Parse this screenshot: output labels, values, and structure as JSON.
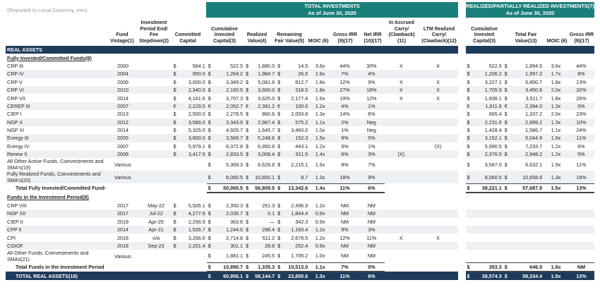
{
  "note": "(Reported in Local Currency, mm)",
  "bands": {
    "total": [
      "TOTAL INVESTMENTS",
      "As of June 30, 2020"
    ],
    "realized": [
      "REALIZED/PARTIALLY REALIZED INVESTMENTS(7)",
      "As of June 30, 2020"
    ]
  },
  "headers": {
    "vintage": "Fund Vintage(1)",
    "period": "Investment Period End/ Fee Stepdown(2)",
    "committed": "Committed Capital",
    "cum_invested": "Cumulative Invested Capital(3)",
    "realized_value": "Realized Value(4)",
    "remaining": "Remaining Fair Value(5)",
    "moic": "MOIC (6)",
    "gross_irr": "Gross IRR (9)(17)",
    "net_irr": "Net IRR (10)(17)",
    "accrued": "In Accrued Carry/ (Clawback)(11)",
    "ltm": "LTM Realized Carry/ (Clawback)(12)",
    "r_cum_invested": "Cumulative Invested Capital(3)",
    "r_fair_value": "Total Fair Value(13)",
    "r_moic": "MOIC (6)",
    "r_gross_irr": "Gross IRR (9)(17)"
  },
  "rows": [
    {
      "type": "section",
      "name": "REAL ASSETS"
    },
    {
      "type": "sub",
      "name": "Fully Invested/Committed Funds(8)"
    },
    {
      "name": "CRP III",
      "vintage": "2000",
      "period": "",
      "cc": "$",
      "committed": "564.1",
      "ci": "$",
      "invested": "522.5",
      "rv": "$",
      "realized": "1,880.0",
      "fv": "$",
      "remaining": "14.5",
      "moic": "3.6x",
      "girr": "44%",
      "nirr": "30%",
      "accrued": "X",
      "ltm": "X",
      "rc": "$",
      "r_invested": "522.5",
      "rf": "$",
      "r_fair": "1,894.5",
      "r_moic": "3.6x",
      "r_girr": "44%"
    },
    {
      "name": "CRP IV",
      "vintage": "2004",
      "period": "",
      "cc": "$",
      "committed": "950.0",
      "ci": "$",
      "invested": "1,264.2",
      "rv": "$",
      "realized": "1,984.7",
      "fv": "$",
      "remaining": "26.5",
      "moic": "1.6x",
      "girr": "7%",
      "nirr": "4%",
      "accrued": "",
      "ltm": "",
      "rc": "$",
      "r_invested": "1,206.2",
      "rf": "$",
      "r_fair": "1,997.2",
      "r_moic": "1.7x",
      "r_girr": "8%"
    },
    {
      "name": "CRP V",
      "vintage": "2006",
      "period": "",
      "cc": "$",
      "committed": "3,000.0",
      "ci": "$",
      "invested": "3,349.2",
      "rv": "$",
      "realized": "5,081.9",
      "fv": "$",
      "remaining": "812.7",
      "moic": "1.8x",
      "girr": "12%",
      "nirr": "9%",
      "accrued": "X",
      "ltm": "X",
      "rc": "$",
      "r_invested": "3,227.1",
      "rf": "$",
      "r_fair": "5,800.7",
      "r_moic": "1.8x",
      "r_girr": "13%"
    },
    {
      "name": "CRP VI",
      "vintage": "2010",
      "period": "",
      "cc": "$",
      "committed": "2,340.0",
      "ci": "$",
      "invested": "2,160.5",
      "rv": "$",
      "realized": "3,600.0",
      "fv": "$",
      "remaining": "316.5",
      "moic": "1.8x",
      "girr": "27%",
      "nirr": "18%",
      "accrued": "X",
      "ltm": "X",
      "rc": "$",
      "r_invested": "1,705.9",
      "rf": "$",
      "r_fair": "3,450.6",
      "r_moic": "2.0x",
      "r_girr": "32%"
    },
    {
      "name": "CRP VII",
      "vintage": "2014",
      "period": "",
      "cc": "$",
      "committed": "4,161.6",
      "ci": "$",
      "invested": "3,707.3",
      "rv": "$",
      "realized": "3,625.0",
      "fv": "$",
      "remaining": "2,177.4",
      "moic": "1.6x",
      "girr": "19%",
      "nirr": "12%",
      "accrued": "X",
      "ltm": "X",
      "rc": "$",
      "r_invested": "1,938.1",
      "rf": "$",
      "r_fair": "3,511.7",
      "r_moic": "1.8x",
      "r_girr": "26%"
    },
    {
      "name": "CEREP III",
      "vintage": "2007",
      "period": "",
      "cc": "€",
      "committed": "2,229.5",
      "ci": "€",
      "invested": "2,052.7",
      "rv": "€",
      "realized": "2,381.2",
      "fv": "€",
      "remaining": "100.0",
      "moic": "1.2x",
      "girr": "4%",
      "nirr": "1%",
      "accrued": "",
      "ltm": "",
      "rc": "€",
      "r_invested": "1,911.6",
      "rf": "€",
      "r_fair": "2,394.0",
      "r_moic": "1.3x",
      "r_girr": "5%"
    },
    {
      "name": "CIEP I",
      "vintage": "2013",
      "period": "",
      "cc": "$",
      "committed": "2,500.0",
      "ci": "$",
      "invested": "2,278.5",
      "rv": "$",
      "realized": "860.6",
      "fv": "$",
      "remaining": "2,093.8",
      "moic": "1.3x",
      "girr": "14%",
      "nirr": "6%",
      "accrued": "",
      "ltm": "",
      "rc": "$",
      "r_invested": "665.4",
      "rf": "$",
      "r_fair": "1,337.2",
      "r_moic": "2.0x",
      "r_girr": "23%"
    },
    {
      "name": "NGP X",
      "vintage": "2012",
      "period": "",
      "cc": "$",
      "committed": "3,586.0",
      "ci": "$",
      "invested": "3,343.9",
      "rv": "$",
      "realized": "2,967.4",
      "fv": "$",
      "remaining": "575.2",
      "moic": "1.1x",
      "girr": "2%",
      "nirr": "Neg",
      "accrued": "",
      "ltm": "",
      "rc": "$",
      "r_invested": "2,231.6",
      "rf": "$",
      "r_fair": "2,899.2",
      "r_moic": "1.3x",
      "r_girr": "10%"
    },
    {
      "name": "NGP XI",
      "vintage": "2014",
      "period": "",
      "cc": "$",
      "committed": "5,325.0",
      "ci": "$",
      "invested": "4,925.7",
      "rv": "$",
      "realized": "1,645.7",
      "fv": "$",
      "remaining": "3,483.0",
      "moic": "1.0x",
      "girr": "1%",
      "nirr": "Neg",
      "accrued": "",
      "ltm": "",
      "rc": "$",
      "r_invested": "1,428.4",
      "rf": "$",
      "r_fair": "1,586.7",
      "r_moic": "1.1x",
      "r_girr": "24%"
    },
    {
      "name": "Energy III",
      "vintage": "2005",
      "period": "",
      "cc": "$",
      "committed": "3,800.0",
      "ci": "$",
      "invested": "3,569.7",
      "rv": "$",
      "realized": "5,248.6",
      "fv": "$",
      "remaining": "152.3",
      "moic": "1.5x",
      "girr": "9%",
      "nirr": "5%",
      "accrued": "",
      "ltm": "",
      "rc": "$",
      "r_invested": "3,152.1",
      "rf": "$",
      "r_fair": "5,044.9",
      "r_moic": "1.6x",
      "r_girr": "11%"
    },
    {
      "name": "Energy IV",
      "vintage": "2007",
      "period": "",
      "cc": "$",
      "committed": "5,979.1",
      "ci": "$",
      "invested": "6,372.8",
      "rv": "$",
      "realized": "6,950.8",
      "fv": "$",
      "remaining": "443.1",
      "moic": "1.2x",
      "girr": "5%",
      "nirr": "1%",
      "accrued": "",
      "ltm": "(X)",
      "rc": "$",
      "r_invested": "5,990.5",
      "rf": "$",
      "r_fair": "7,233.7",
      "r_moic": "1.2x",
      "r_girr": "6%"
    },
    {
      "name": "Renew II",
      "vintage": "2008",
      "period": "",
      "cc": "$",
      "committed": "3,417.5",
      "ci": "$",
      "invested": "2,833.5",
      "rv": "$",
      "realized": "3,008.4",
      "fv": "$",
      "remaining": "911.5",
      "moic": "1.4x",
      "girr": "6%",
      "nirr": "3%",
      "accrued": "(X)",
      "ltm": "",
      "rc": "$",
      "r_invested": "2,376.5",
      "rf": "$",
      "r_fair": "2,948.2",
      "r_moic": "1.2x",
      "r_girr": "5%"
    },
    {
      "name": "All Other Active Funds, Coinvestments and SMA's(19)",
      "tall": true,
      "vintage": "Various",
      "period": "",
      "cc": "",
      "committed": "",
      "ci": "$",
      "invested": "5,369.3",
      "rv": "$",
      "realized": "6,628.8",
      "fv": "$",
      "remaining": "2,215.1",
      "moic": "1.6x",
      "girr": "8%",
      "nirr": "7%",
      "accrued": "",
      "ltm": "",
      "rc": "$",
      "r_invested": "3,567.0",
      "rf": "$",
      "r_fair": "6,632.1",
      "r_moic": "1.9x",
      "r_girr": "11%"
    },
    {
      "name": "Fully Realized Funds, Coinvestments and SMA's(20)",
      "tall": true,
      "vintage": "Various",
      "period": "",
      "cc": "",
      "committed": "",
      "ci": "$",
      "invested": "8,060.5",
      "rv": "$",
      "realized": "10,650.1",
      "fv": "$",
      "remaining": "8.7",
      "moic": "1.3x",
      "girr": "18%",
      "nirr": "9%",
      "accrued": "",
      "ltm": "",
      "rc": "$",
      "r_invested": "8,060.5",
      "rf": "$",
      "r_fair": "10,658.8",
      "r_moic": "1.3x",
      "r_girr": "18%"
    },
    {
      "type": "total",
      "name": "Total Fully Invested/Committed Funds",
      "ci": "$",
      "invested": "50,065.5",
      "rv": "$",
      "realized": "56,809.5",
      "fv": "$",
      "remaining": "13,342.6",
      "moic": "1.4x",
      "girr": "11%",
      "nirr": "6%",
      "rc": "$",
      "r_invested": "38,221.1",
      "rf": "$",
      "r_fair": "57,687.9",
      "r_moic": "1.5x",
      "r_girr": "13%"
    },
    {
      "type": "sub",
      "name": "Funds in the Investment Period(8)"
    },
    {
      "name": "CRP VIII",
      "vintage": "2017",
      "period": "May-22",
      "cc": "$",
      "committed": "5,505.1",
      "ci": "$",
      "invested": "2,350.3",
      "rv": "$",
      "realized": "251.3",
      "fv": "$",
      "remaining": "2,496.9",
      "moic": "1.2x",
      "girr": "NM",
      "nirr": "NM",
      "accrued": "",
      "ltm": "",
      "rc": "",
      "r_invested": "",
      "rf": "",
      "r_fair": "",
      "r_moic": "",
      "r_girr": ""
    },
    {
      "name": "NGP XII",
      "vintage": "2017",
      "period": "Jul-22",
      "cc": "$",
      "committed": "4,277.6",
      "ci": "$",
      "invested": "2,035.7",
      "rv": "$",
      "realized": "0.1",
      "fv": "$",
      "remaining": "1,844.4",
      "moic": "0.9x",
      "girr": "NM",
      "nirr": "NM",
      "accrued": "",
      "ltm": "",
      "rc": "",
      "r_invested": "",
      "rf": "",
      "r_fair": "",
      "r_moic": "",
      "r_girr": ""
    },
    {
      "name": "CIEP II",
      "vintage": "2019",
      "period": "Apr-25",
      "cc": "$",
      "committed": "2,256.9",
      "ci": "$",
      "invested": "363.6",
      "rv": "$",
      "realized": "—",
      "fv": "$",
      "remaining": "342.3",
      "moic": "0.9x",
      "girr": "NM",
      "nirr": "NM",
      "accrued": "",
      "ltm": "",
      "rc": "",
      "r_invested": "",
      "rf": "",
      "r_fair": "",
      "r_moic": "",
      "r_girr": ""
    },
    {
      "name": "CPP II",
      "vintage": "2014",
      "period": "Apr-21",
      "cc": "$",
      "committed": "1,526.7",
      "ci": "$",
      "invested": "1,244.0",
      "rv": "$",
      "realized": "298.4",
      "fv": "$",
      "remaining": "1,193.4",
      "moic": "1.2x",
      "girr": "9%",
      "nirr": "3%",
      "accrued": "",
      "ltm": "",
      "rc": "",
      "r_invested": "",
      "rf": "",
      "r_fair": "",
      "r_moic": "",
      "r_girr": ""
    },
    {
      "name": "CPI",
      "vintage": "2016",
      "period": "n/a",
      "cc": "$",
      "committed": "3,266.6",
      "ci": "$",
      "invested": "2,714.8",
      "rv": "$",
      "realized": "511.2",
      "fv": "$",
      "remaining": "2,678.5",
      "moic": "1.2x",
      "girr": "12%",
      "nirr": "11%",
      "accrued": "X",
      "ltm": "X",
      "rc": "",
      "r_invested": "",
      "rf": "",
      "r_fair": "",
      "r_moic": "",
      "r_girr": ""
    },
    {
      "name": "CGIOF",
      "vintage": "2018",
      "period": "Sep-23",
      "cc": "$",
      "committed": "2,201.4",
      "ci": "$",
      "invested": "301.1",
      "rv": "$",
      "realized": "28.8",
      "fv": "$",
      "remaining": "252.4",
      "moic": "0.9x",
      "girr": "NM",
      "nirr": "NM",
      "accrued": "",
      "ltm": "",
      "rc": "",
      "r_invested": "",
      "rf": "",
      "r_fair": "",
      "r_moic": "",
      "r_girr": ""
    },
    {
      "name": "All Other Funds, Coinvestments and SMAs(21)",
      "tall": true,
      "vintage": "Various",
      "period": "",
      "cc": "",
      "committed": "",
      "ci": "$",
      "invested": "1,881.1",
      "rv": "$",
      "realized": "245.5",
      "fv": "$",
      "remaining": "1,705.2",
      "moic": "1.0x",
      "girr": "NM",
      "nirr": "NM",
      "accrued": "",
      "ltm": "",
      "rc": "",
      "r_invested": "",
      "rf": "",
      "r_fair": "",
      "r_moic": "",
      "r_girr": ""
    },
    {
      "type": "total",
      "name": "Total Funds in the Investment Period",
      "ci": "$",
      "invested": "10,890.7",
      "rv": "$",
      "realized": "1,335.3",
      "fv": "$",
      "remaining": "10,513.0",
      "moic": "1.1x",
      "girr": "7%",
      "nirr": "0%",
      "rc": "$",
      "r_invested": "353.3",
      "rf": "$",
      "r_fair": "646.5",
      "r_moic": "1.8x",
      "r_girr": "NM"
    },
    {
      "type": "grand",
      "name": "TOTAL REAL ASSETS(18)",
      "ci": "$",
      "invested": "60,956.1",
      "rv": "$",
      "realized": "58,144.7",
      "fv": "$",
      "remaining": "23,855.6",
      "moic": "1.3x",
      "girr": "11%",
      "nirr": "6%",
      "rc": "$",
      "r_invested": "38,574.3",
      "rf": "$",
      "r_fair": "58,334.4",
      "r_moic": "1.5x",
      "r_girr": "13%"
    }
  ]
}
